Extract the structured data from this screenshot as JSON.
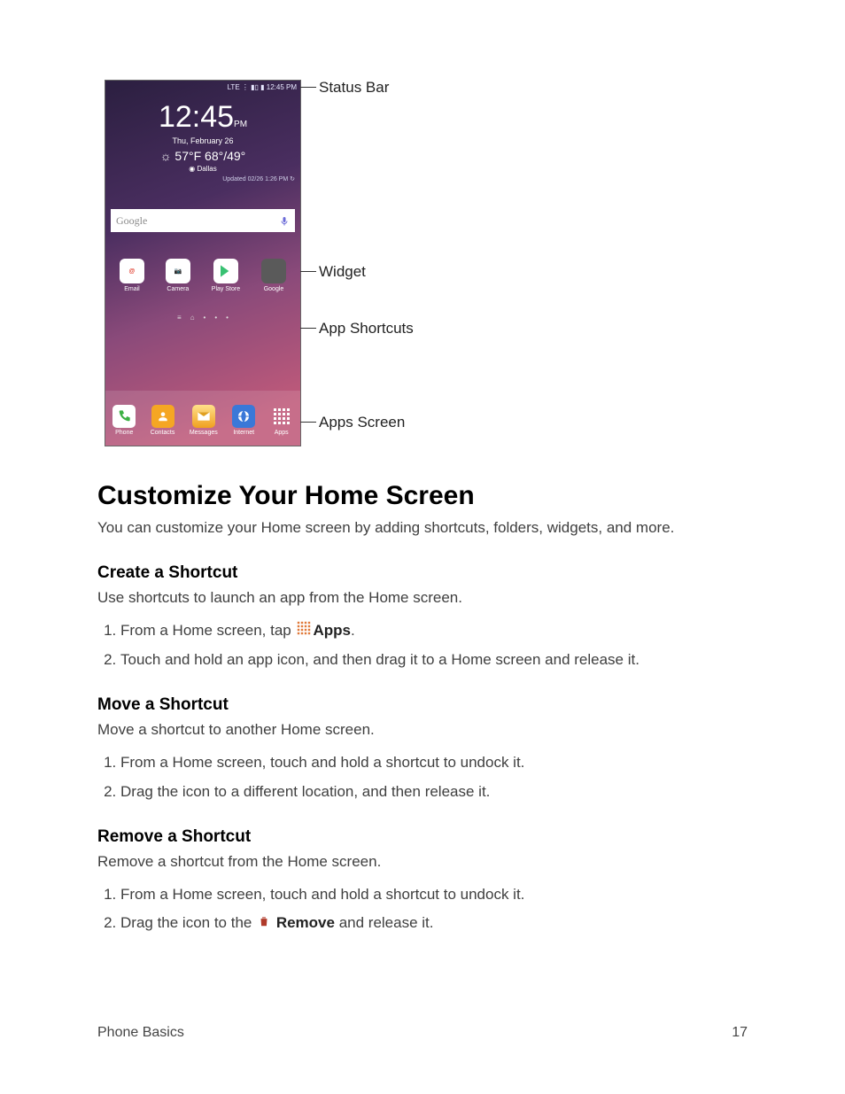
{
  "figure": {
    "statusbar_text": "LTE ⋮ ▮▯ ▮ 12:45 PM",
    "clock": "12:45",
    "clock_suffix": "PM",
    "date": "Thu, February 26",
    "weather": "☼ 57°F 68°/49°",
    "location": "◉ Dallas",
    "updated": "Updated 02/26 1:26 PM ↻",
    "google_label": "Google",
    "shortcuts": [
      {
        "label": "Email"
      },
      {
        "label": "Camera"
      },
      {
        "label": "Play Store"
      },
      {
        "label": "Google"
      }
    ],
    "dock": [
      {
        "label": "Phone"
      },
      {
        "label": "Contacts"
      },
      {
        "label": "Messages"
      },
      {
        "label": "Internet"
      },
      {
        "label": "Apps"
      }
    ],
    "callouts": {
      "status_bar": "Status Bar",
      "widget": "Widget",
      "app_shortcuts": "App Shortcuts",
      "apps_screen": "Apps Screen"
    }
  },
  "headings": {
    "customize": "Customize Your Home Screen",
    "create": "Create a Shortcut",
    "move": "Move a Shortcut",
    "remove": "Remove a Shortcut"
  },
  "paragraphs": {
    "customize_intro": "You can customize your Home screen by adding shortcuts, folders, widgets, and more.",
    "create_intro": "Use shortcuts to launch an app from the Home screen.",
    "move_intro": "Move a shortcut to another Home screen.",
    "remove_intro": "Remove a shortcut from the Home screen."
  },
  "steps": {
    "create": {
      "s1_pre": "From a Home screen, tap ",
      "s1_bold": "Apps",
      "s1_post": ".",
      "s2": "Touch and hold an app icon, and then drag it to a Home screen and release it."
    },
    "move": {
      "s1": "From a Home screen, touch and hold a shortcut to undock it.",
      "s2": "Drag the icon to a different location, and then release it."
    },
    "remove": {
      "s1": "From a Home screen, touch and hold a shortcut to undock it.",
      "s2_pre": "Drag the icon to the ",
      "s2_bold": "Remove",
      "s2_post": " and release it."
    }
  },
  "footer": {
    "section": "Phone Basics",
    "page": "17"
  }
}
